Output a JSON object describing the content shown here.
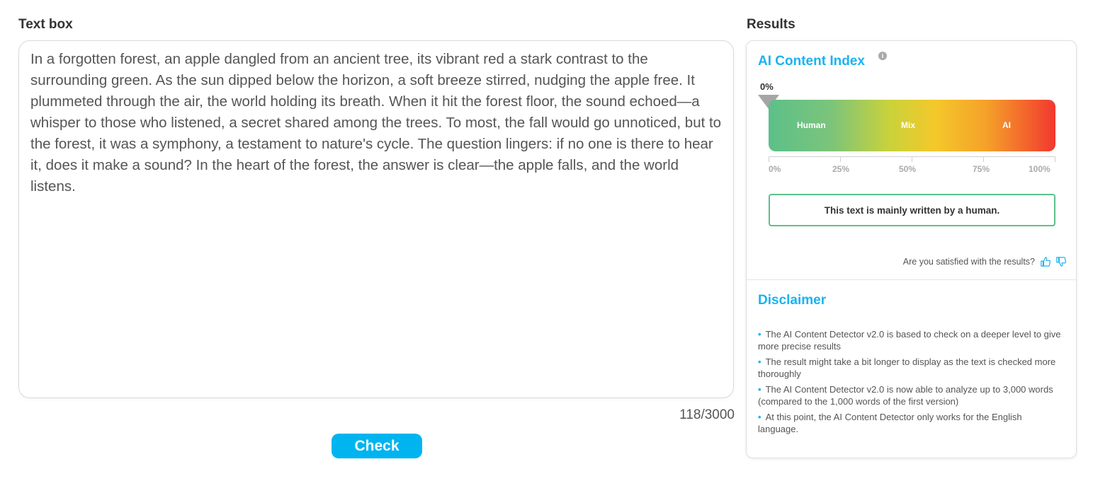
{
  "textbox": {
    "title": "Text box",
    "content": "In a forgotten forest, an apple dangled from an ancient tree, its vibrant red a stark contrast to the surrounding green. As the sun dipped below the horizon, a soft breeze stirred, nudging the apple free. It plummeted through the air, the world holding its breath. When it hit the forest floor, the sound echoed—a whisper to those who listened, a secret shared among the trees. To most, the fall would go unnoticed, but to the forest, it was a symphony, a testament to nature's cycle. The question lingers: if no one is there to hear it, does it make a sound? In the heart of the forest, the answer is clear—the apple falls, and the world listens.",
    "char_count": "118/3000",
    "check_label": "Check"
  },
  "results": {
    "title": "Results",
    "index_title": "AI Content Index",
    "info_icon": "info-icon",
    "ai_percent_label": "0%",
    "ai_percent_value": 0,
    "gauge_labels": {
      "human": "Human",
      "mix": "Mix",
      "ai": "AI"
    },
    "ticks": [
      "0%",
      "25%",
      "50%",
      "75%",
      "100%"
    ],
    "verdict": "This text is mainly written by a human.",
    "feedback_question": "Are you satisfied with the results?",
    "colors": {
      "accent": "#1ab3f0",
      "human": "#5cc08a",
      "ai": "#f2382f",
      "check_button": "#00b4f0"
    }
  },
  "disclaimer": {
    "title": "Disclaimer",
    "items": [
      "The AI Content Detector v2.0 is based to check on a deeper level to give more precise results",
      "The result might take a bit longer to display as the text is checked more thoroughly",
      "The AI Content Detector v2.0 is now able to analyze up to 3,000 words (compared to the 1,000 words of the first version)",
      "At this point, the AI Content Detector only works for the English language."
    ]
  }
}
